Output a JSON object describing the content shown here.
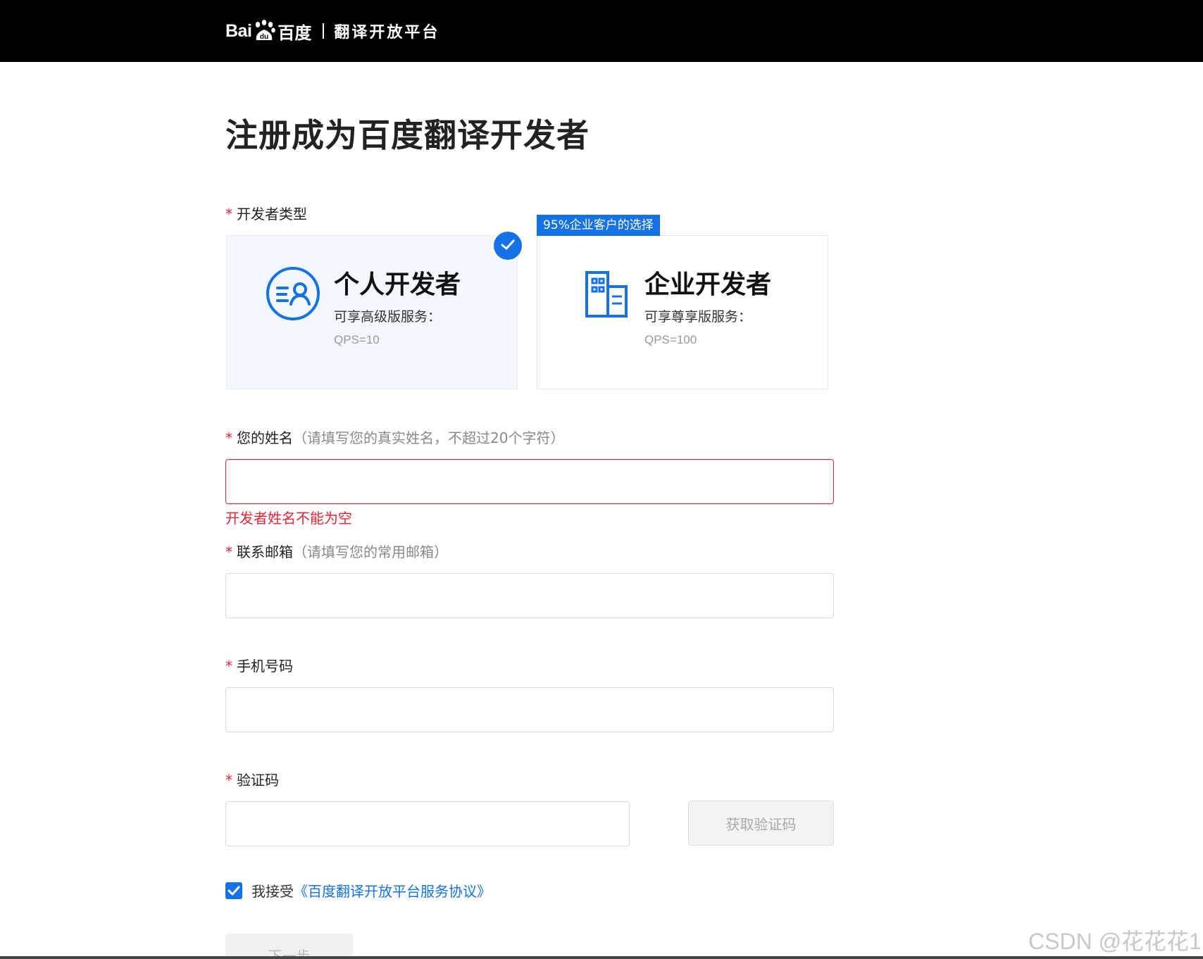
{
  "header": {
    "logo_bai": "Bai",
    "logo_cn": "百度",
    "subtitle": "翻译开放平台"
  },
  "page": {
    "title": "注册成为百度翻译开发者"
  },
  "developer_type": {
    "label": "开发者类型",
    "required_mark": "*",
    "personal": {
      "title": "个人开发者",
      "desc": "可享高级版服务：",
      "qps": "QPS=10",
      "selected": true
    },
    "enterprise": {
      "tag": "95%企业客户的选择",
      "title": "企业开发者",
      "desc": "可享尊享版服务：",
      "qps": "QPS=100",
      "selected": false
    }
  },
  "form": {
    "name": {
      "label": "您的姓名",
      "hint": "（请填写您的真实姓名，不超过20个字符）",
      "value": "",
      "error": "开发者姓名不能为空"
    },
    "email": {
      "label": "联系邮箱",
      "hint": "（请填写您的常用邮箱）",
      "value": ""
    },
    "phone": {
      "label": "手机号码",
      "value": ""
    },
    "code": {
      "label": "验证码",
      "value": "",
      "button": "获取验证码"
    },
    "required_mark": "*"
  },
  "agreement": {
    "checked": true,
    "text": "我接受",
    "link": "《百度翻译开放平台服务协议》"
  },
  "next_button": "下一步",
  "watermark": "CSDN @花花花1",
  "colors": {
    "primary": "#1472e6",
    "error": "#ee2233",
    "header_bg": "#000000"
  }
}
